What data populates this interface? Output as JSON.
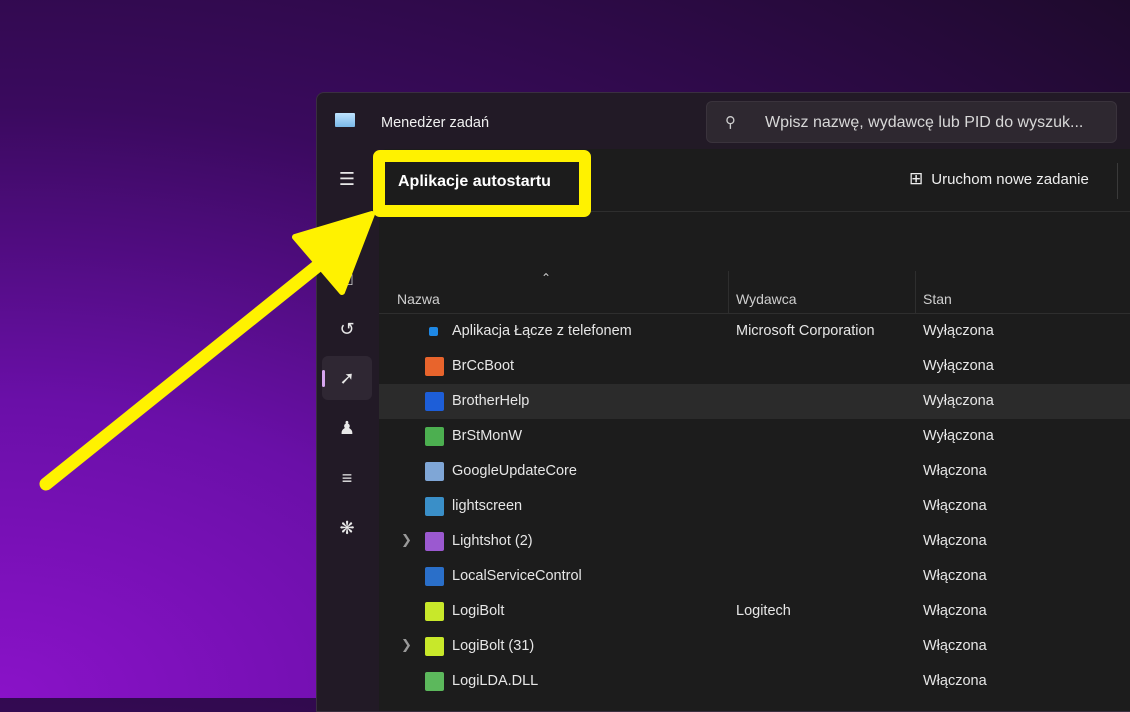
{
  "window": {
    "title": "Menedżer zadań",
    "search_placeholder": "Wpisz nazwę, wydawcę lub PID do wyszuk..."
  },
  "sidebar": {
    "items": [
      {
        "icon": "hamburger-icon"
      },
      {
        "icon": "processes-icon"
      },
      {
        "icon": "performance-icon"
      },
      {
        "icon": "app-history-icon"
      },
      {
        "icon": "startup-apps-icon",
        "active": true
      },
      {
        "icon": "users-icon"
      },
      {
        "icon": "details-icon"
      },
      {
        "icon": "services-icon"
      }
    ]
  },
  "page": {
    "title": "Aplikacje autostartu",
    "new_task_label": "Uruchom nowe zadanie"
  },
  "columns": {
    "name": "Nazwa",
    "publisher": "Wydawca",
    "status": "Stan"
  },
  "rows": [
    {
      "name": "Aplikacja Łącze z telefonem",
      "publisher": "Microsoft Corporation",
      "status": "Wyłączona",
      "color": "#1e88e5"
    },
    {
      "name": "BrCcBoot",
      "publisher": "",
      "status": "Wyłączona",
      "color": "#e8642c"
    },
    {
      "name": "BrotherHelp",
      "publisher": "",
      "status": "Wyłączona",
      "color": "#1d5ed8"
    },
    {
      "name": "BrStMonW",
      "publisher": "",
      "status": "Wyłączona",
      "color": "#4caf50"
    },
    {
      "name": "GoogleUpdateCore",
      "publisher": "",
      "status": "Włączona",
      "color": "#7fa6d6"
    },
    {
      "name": "lightscreen",
      "publisher": "",
      "status": "Włączona",
      "color": "#3a8fc8"
    },
    {
      "name": "Lightshot (2)",
      "publisher": "",
      "status": "Włączona",
      "color": "#9b59d0",
      "expandable": true
    },
    {
      "name": "LocalServiceControl",
      "publisher": "",
      "status": "Włączona",
      "color": "#2a6fc9"
    },
    {
      "name": "LogiBolt",
      "publisher": "Logitech",
      "status": "Włączona",
      "color": "#c8e82a"
    },
    {
      "name": "LogiBolt (31)",
      "publisher": "",
      "status": "Włączona",
      "color": "#c8e82a",
      "expandable": true
    },
    {
      "name": "LogiLDA.DLL",
      "publisher": "",
      "status": "Włączona",
      "color": "#5cb85c"
    }
  ],
  "annotation": {
    "color": "#fff200"
  }
}
